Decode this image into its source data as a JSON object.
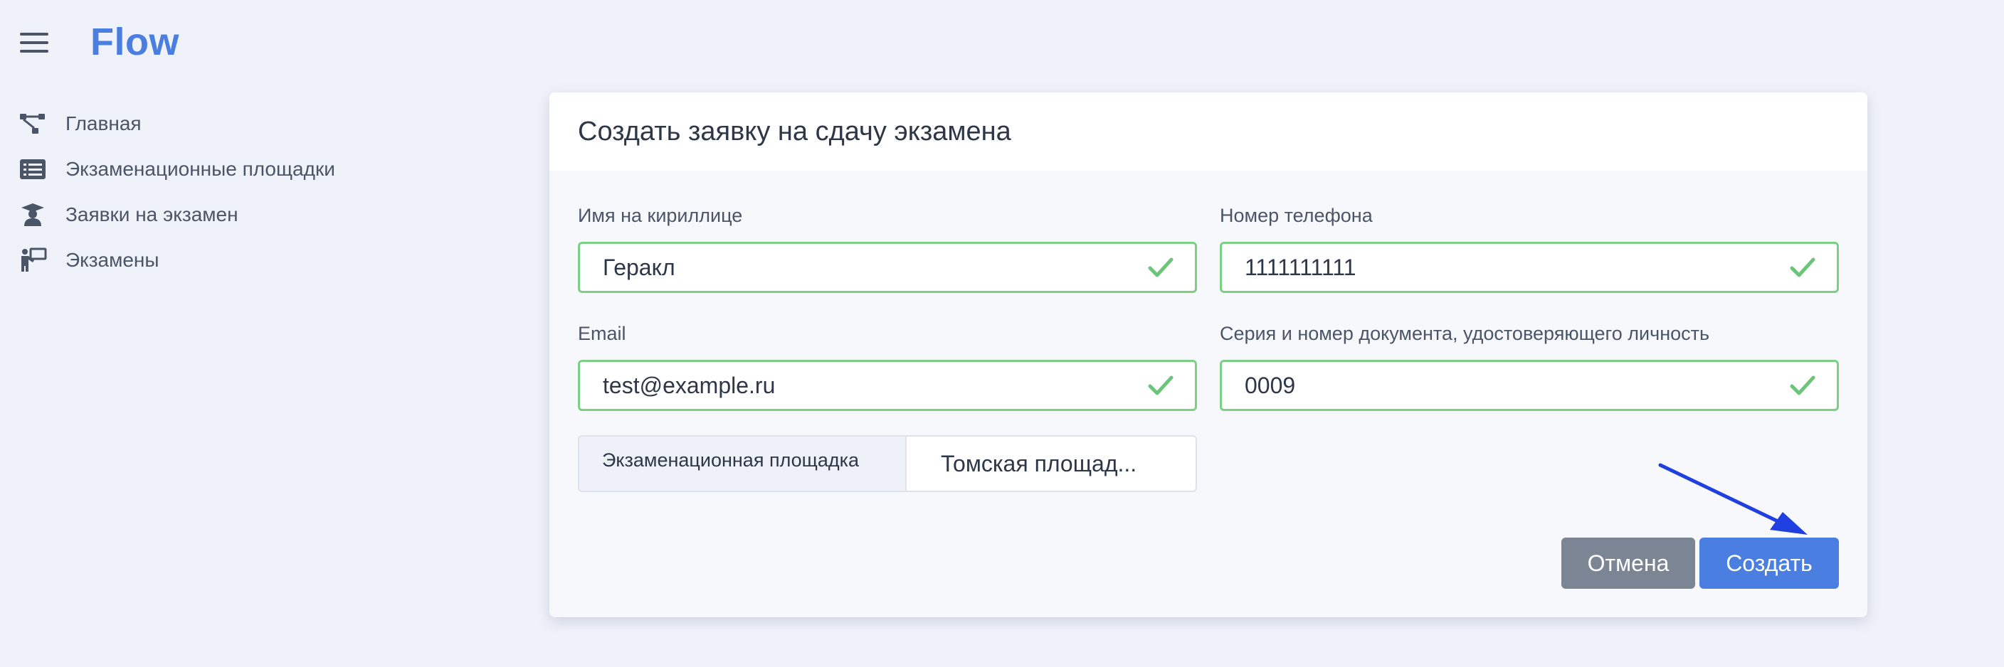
{
  "app": {
    "brand": "Flow",
    "accent_color": "#4a7ee0"
  },
  "sidebar": {
    "items": [
      {
        "icon": "flow-diagram-icon",
        "label": "Главная"
      },
      {
        "icon": "list-icon",
        "label": "Экзаменационные площадки"
      },
      {
        "icon": "graduate-icon",
        "label": "Заявки на экзамен"
      },
      {
        "icon": "teacher-board-icon",
        "label": "Экзамены"
      }
    ]
  },
  "modal": {
    "title": "Создать заявку на сдачу экзамена",
    "fields": {
      "name": {
        "label": "Имя на кириллице",
        "value": "Геракл"
      },
      "phone": {
        "label": "Номер телефона",
        "value": "1111111111"
      },
      "email": {
        "label": "Email",
        "value": "test@example.ru"
      },
      "document": {
        "label": "Серия и номер документа, удостоверяющего личность",
        "value": "0009"
      }
    },
    "venue": {
      "label": "Экзаменационная площадка",
      "selected": "Томская площад..."
    },
    "buttons": {
      "cancel": "Отмена",
      "create": "Создать"
    }
  },
  "colors": {
    "valid_border": "#7ccf84",
    "cancel_button": "#7c8594",
    "create_button": "#4a7ee0",
    "annotation_arrow": "#1f3fe0"
  }
}
